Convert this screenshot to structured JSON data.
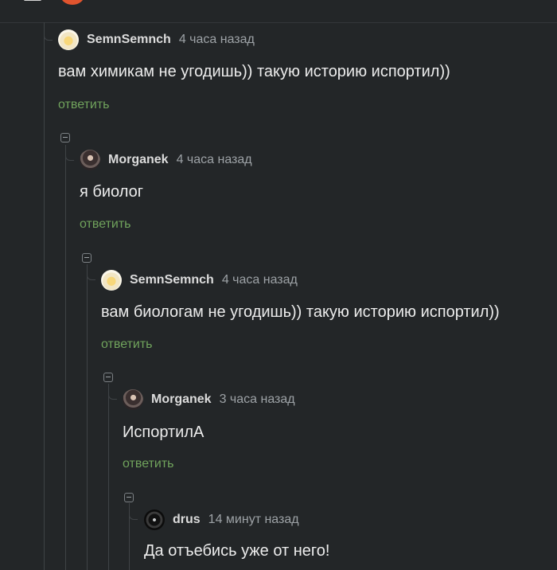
{
  "comments": [
    {
      "user": "SemnSemnch",
      "time": "4 часа назад",
      "text": "вам химикам не угодишь)) такую историю испортил))",
      "reply": "ответить",
      "avatar_icon": "yellow-avatar-icon"
    },
    {
      "user": "Morganek",
      "time": "4 часа назад",
      "text": "я биолог",
      "reply": "ответить",
      "avatar_icon": "dark-avatar-icon"
    },
    {
      "user": "SemnSemnch",
      "time": "4 часа назад",
      "text": "вам биологам не угодишь)) такую историю испортил))",
      "reply": "ответить",
      "avatar_icon": "yellow-avatar-icon"
    },
    {
      "user": "Morganek",
      "time": "3 часа назад",
      "text": "ИспортилА",
      "reply": "ответить",
      "avatar_icon": "dark-avatar-icon"
    },
    {
      "user": "drus",
      "time": "14 минут назад",
      "text": "Да отъебись уже от него!",
      "avatar_icon": "black-avatar-icon"
    }
  ],
  "colors": {
    "background": "#232628",
    "reply_link": "#70a35c",
    "meta_text": "#9da2a6"
  }
}
